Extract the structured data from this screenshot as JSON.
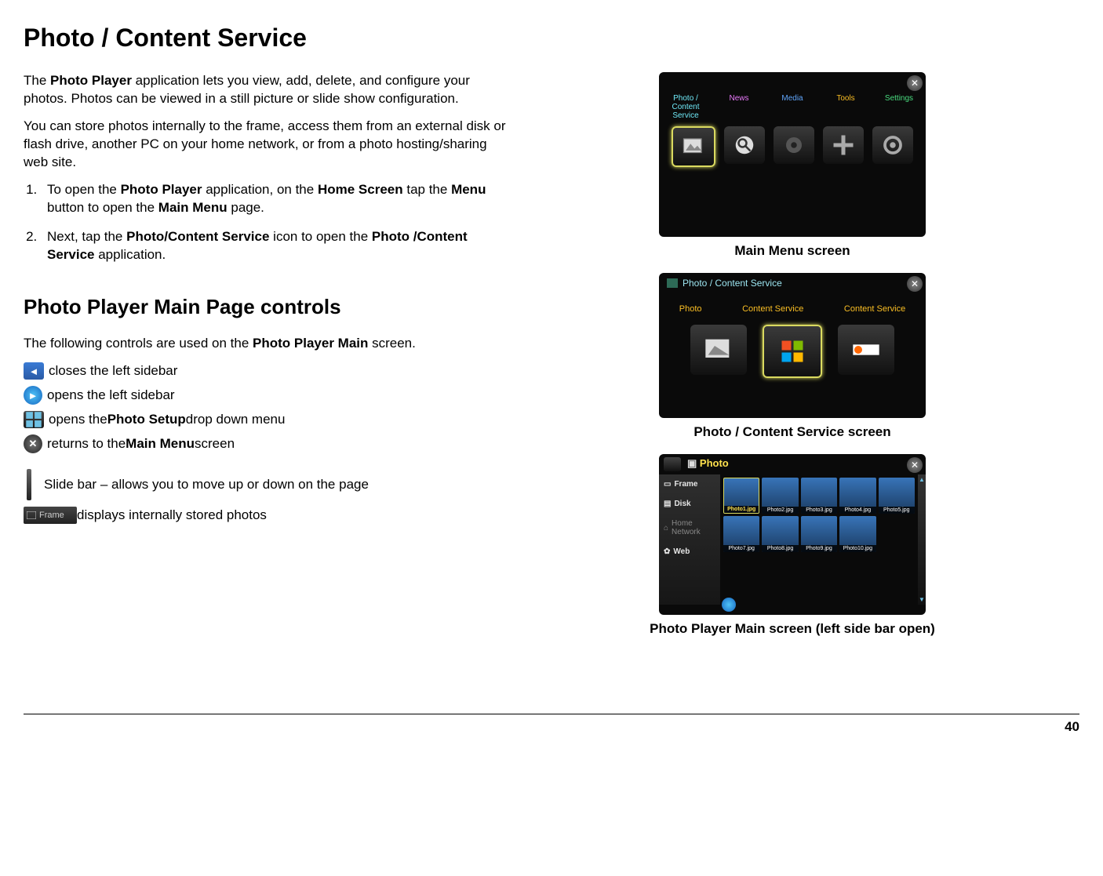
{
  "page_number": "40",
  "title": "Photo / Content Service",
  "intro": {
    "p1_pre": "The ",
    "p1_b1": "Photo Player",
    "p1_post": " application lets you view, add, delete, and configure your photos.  Photos can be viewed in a still picture or slide show configuration.",
    "p2": "You can store photos internally to the frame, access them from an external disk or flash drive, another PC on your home network, or from a photo hosting/sharing web site."
  },
  "steps": {
    "s1_pre": "To open the ",
    "s1_b1": "Photo Player",
    "s1_mid1": " application, on the ",
    "s1_b2": "Home Screen",
    "s1_mid2": " tap the ",
    "s1_b3": "Menu",
    "s1_mid3": " button to open the ",
    "s1_b4": "Main Menu",
    "s1_post": " page.",
    "s2_pre": "Next, tap the ",
    "s2_b1": "Photo/Content Service",
    "s2_mid": " icon to open the ",
    "s2_b2": "Photo /Content Service",
    "s2_post": " application."
  },
  "section2_title": "Photo Player Main Page controls",
  "section2_intro_pre": "The following controls are used on the ",
  "section2_intro_b": "Photo Player Main",
  "section2_intro_post": " screen.",
  "controls": {
    "c1": "closes the left sidebar",
    "c2": " opens the left sidebar",
    "c3_pre": " opens the ",
    "c3_b": "Photo Setup",
    "c3_post": " drop down menu",
    "c4_pre": " returns to the ",
    "c4_b": "Main Menu",
    "c4_post": " screen",
    "c5": " Slide bar – allows you to move up or down on the page",
    "c6": " displays internally stored photos",
    "frame_label": "Frame"
  },
  "captions": {
    "cap1": "Main Menu screen",
    "cap2": "Photo / Content Service screen",
    "cap3": "Photo Player Main screen (left side bar open)"
  },
  "ss1": {
    "tabs": [
      "Photo / Content Service",
      "News",
      "Media",
      "Tools",
      "Settings"
    ]
  },
  "ss2": {
    "title": "Photo / Content Service",
    "tabs": [
      "Photo",
      "Content Service",
      "Content Service"
    ]
  },
  "ss3": {
    "title": "Photo",
    "sidebar": [
      "Frame",
      "Disk",
      "Home Network",
      "Web"
    ],
    "thumbs": [
      "Photo1.jpg",
      "Photo2.jpg",
      "Photo3.jpg",
      "Photo4.jpg",
      "Photo5.jpg",
      "Photo7.jpg",
      "Photo8.jpg",
      "Photo9.jpg",
      "Photo10.jpg"
    ]
  }
}
